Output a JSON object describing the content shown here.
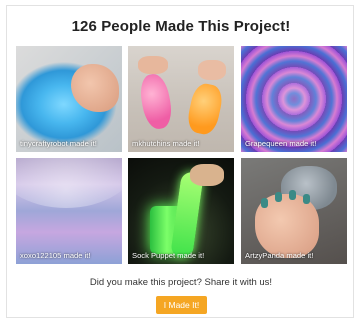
{
  "header": {
    "title": "126 People Made This Project!"
  },
  "gallery": {
    "items": [
      {
        "caption": "tinycraftyrobot made it!"
      },
      {
        "caption": "mkhutchins made it!"
      },
      {
        "caption": "Grapequeen made it!"
      },
      {
        "caption": "xoxo122105 made it!"
      },
      {
        "caption": "Sock Puppet made it!"
      },
      {
        "caption": "ArtzyPanda made it!"
      }
    ]
  },
  "footer": {
    "prompt": "Did you make this project? Share it with us!",
    "button_label": "I Made It!"
  },
  "colors": {
    "accent": "#f5a623"
  }
}
